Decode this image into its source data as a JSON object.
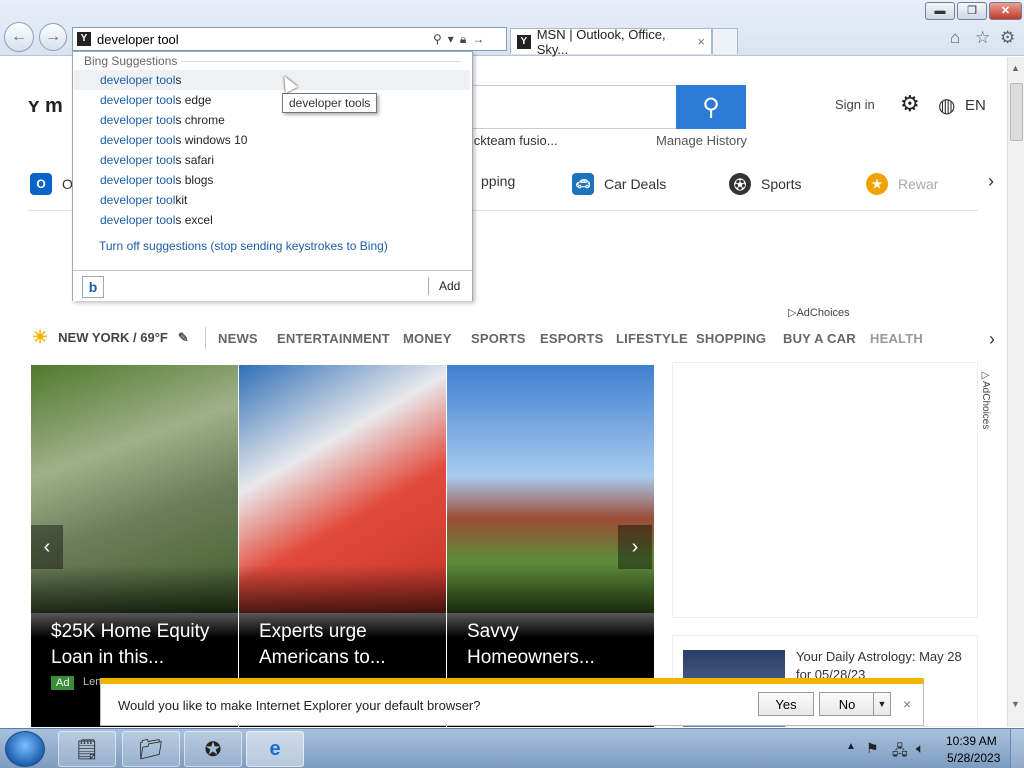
{
  "browser": {
    "address_value": "developer tool",
    "tab_title": "MSN | Outlook, Office, Sky...",
    "tab_close": "×",
    "window_buttons": {
      "minimize": "▬",
      "maximize": "❐",
      "close": "✕"
    },
    "toolbar_icons": [
      "home-icon",
      "star-icon",
      "gear-icon"
    ]
  },
  "autocomplete": {
    "header": "Bing Suggestions",
    "typed": "developer tool",
    "items": [
      {
        "match": "developer tool",
        "rest": "s"
      },
      {
        "match": "developer tool",
        "rest": "s edge"
      },
      {
        "match": "developer tool",
        "rest": "s chrome"
      },
      {
        "match": "developer tool",
        "rest": "s windows 10"
      },
      {
        "match": "developer tool",
        "rest": "s safari"
      },
      {
        "match": "developer tool",
        "rest": "s blogs"
      },
      {
        "match": "developer tool",
        "rest": "kit"
      },
      {
        "match": "developer tool",
        "rest": "s excel"
      }
    ],
    "turn_off": "Turn off suggestions (stop sending keystrokes to Bing)",
    "add_label": "Add",
    "tooltip": "developer tools"
  },
  "msn": {
    "logo_partial": "m",
    "trending_partial": "lickteam fusio...",
    "manage_history": "Manage History",
    "sign_in": "Sign in",
    "language": "EN",
    "quick_links": [
      {
        "label": "O",
        "icon": "outlook-icon",
        "color": "#0a64c8"
      },
      {
        "label": "pping",
        "icon": "",
        "color": ""
      },
      {
        "label": "Car Deals",
        "icon": "car-icon",
        "color": "#1e73be"
      },
      {
        "label": "Sports",
        "icon": "sports-icon",
        "color": "#333"
      },
      {
        "label": "Rewar",
        "icon": "rewards-icon",
        "color": "#f0a300"
      }
    ],
    "ad_choices": "AdChoices",
    "weather": "NEW YORK / 69°F",
    "nav": [
      "NEWS",
      "ENTERTAINMENT",
      "MONEY",
      "SPORTS",
      "ESPORTS",
      "LIFESTYLE",
      "SHOPPING",
      "BUY A CAR",
      "HEALTH"
    ],
    "cards": [
      {
        "caption": "$25K Home Equity Loan in this...",
        "ad": "Ad",
        "source": "Len"
      },
      {
        "caption": "Experts urge Americans to..."
      },
      {
        "caption": "Savvy Homeowners..."
      }
    ],
    "side_ad_choices": "AdChoices",
    "astrology": "Your Daily Astrology: May 28 for 05/28/23"
  },
  "notification": {
    "message": "Would you like to make Internet Explorer your default browser?",
    "yes": "Yes",
    "no": "No",
    "close": "×"
  },
  "taskbar": {
    "time": "10:39 AM",
    "date": "5/28/2023"
  },
  "colors": {
    "accent": "#2c7bd6",
    "link": "#1a5ea8",
    "notify_bar": "#f0b400"
  }
}
